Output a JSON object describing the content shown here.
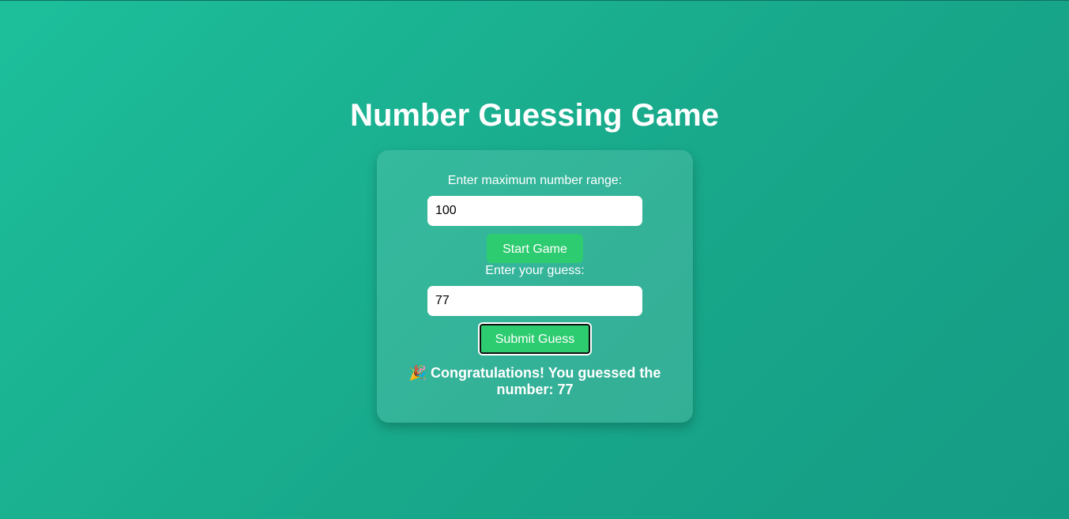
{
  "game": {
    "title": "Number Guessing Game",
    "range_label": "Enter maximum number range:",
    "range_value": "100",
    "start_button": "Start Game",
    "guess_label": "Enter your guess:",
    "guess_value": "77",
    "submit_button": "Submit Guess",
    "result_icon": "party-popper-icon",
    "result_glyph": "🎉",
    "result_message": "Congratulations! You guessed the number: 77"
  },
  "colors": {
    "background_start": "#1dbf9b",
    "background_end": "#159c85",
    "button": "#2ecc71",
    "text": "#ffffff"
  }
}
